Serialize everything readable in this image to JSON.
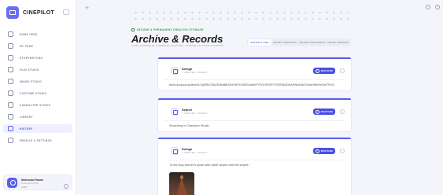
{
  "brand": {
    "name": "CINEPILOT"
  },
  "sidebar": {
    "items": [
      {
        "label": "HOME FEED",
        "icon": "home-icon"
      },
      {
        "label": "MY PAGE",
        "icon": "page-icon"
      },
      {
        "label": "STORYWRITING",
        "icon": "pen-icon"
      },
      {
        "label": "FILM STUDIO",
        "icon": "film-icon"
      },
      {
        "label": "IMAGE STUDIO",
        "icon": "image-icon"
      },
      {
        "label": "COSTUME STUDIO",
        "icon": "shirt-icon"
      },
      {
        "label": "CHARACTER STUDIO",
        "icon": "character-icon"
      },
      {
        "label": "LIBRARY",
        "icon": "library-icon"
      },
      {
        "label": "HISTORY",
        "icon": "history-icon",
        "active": true
      },
      {
        "label": "PROFILE & SETTINGS",
        "icon": "user-icon"
      }
    ],
    "user": {
      "name": "Mahmudul Hasan",
      "role": "FILM ACCOUNT",
      "badge": "LIMIT"
    }
  },
  "header": {
    "eyebrow": "SECURE & PERMANENT CREATIVE STORAGE",
    "title": "Archive & Records",
    "description": "YOUR COMPLETE CINEMATIC HISTORY, SYNCED TO YOUR ACCOUNT",
    "tabs": [
      "ACTIVITY LOG",
      "SCRIPT VERSIONS",
      "STUDIO SNAPSHOTS",
      "IMAGE PRESETS"
    ],
    "active_tab": 0
  },
  "cards": [
    {
      "kind": "Design",
      "meta": "7 CREATED · RECENT",
      "content": "dna:c4cupc/png:8nm0L/3j/8R4O5k2D/8pB8HZnhHEV4GBG4nbtrPYSOHSOR7ITE5RiA3DhAHNhA4bG3xmHMm9cSeI7Px2i",
      "restore_label": "RESTORE"
    },
    {
      "kind": "Search",
      "meta": "7 CREATED · RECENT",
      "content": "Searching in Character Studio",
      "restore_label": "RESTORE"
    },
    {
      "kind": "Design",
      "meta": "7 CREATED · RECENT",
      "content": "\"A red long women's gown with white stripes and red stripes \"",
      "restore_label": "RESTORE"
    }
  ]
}
